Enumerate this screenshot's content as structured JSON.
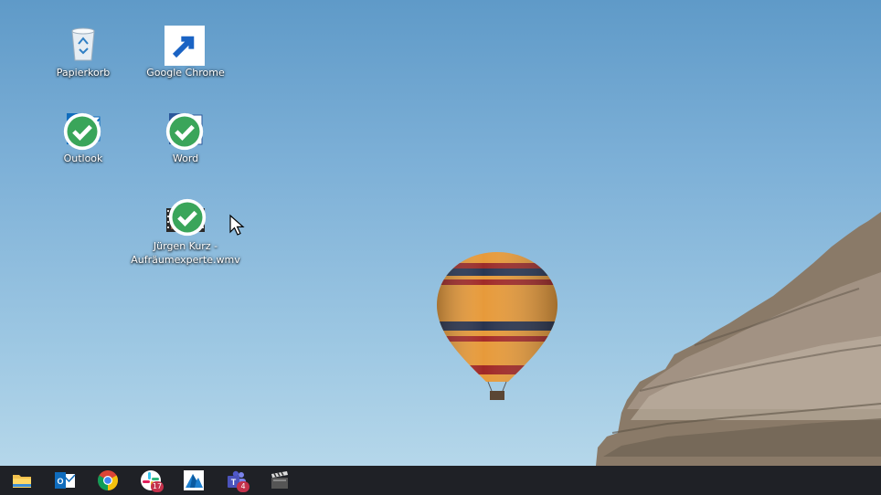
{
  "desktop": {
    "icons": [
      {
        "label": "Papierkorb",
        "icon": "recycle-bin-icon"
      },
      {
        "label": "Google Chrome",
        "icon": "chrome-icon",
        "shortcut": true
      },
      {
        "label": "Outlook",
        "icon": "outlook-icon",
        "synced": true
      },
      {
        "label": "Word",
        "icon": "word-icon",
        "synced": true
      },
      {
        "label_line1": "Jürgen Kurz -",
        "label_line2": "Aufräumexperte.wmv",
        "icon": "video-file-icon",
        "synced": true
      }
    ]
  },
  "taskbar": {
    "items": [
      {
        "name": "file-explorer",
        "icon": "folder-icon"
      },
      {
        "name": "outlook",
        "icon": "outlook-icon"
      },
      {
        "name": "chrome",
        "icon": "chrome-icon"
      },
      {
        "name": "slack",
        "icon": "slack-icon",
        "badge": "17"
      },
      {
        "name": "app-blue",
        "icon": "mountain-app-icon"
      },
      {
        "name": "teams",
        "icon": "teams-icon",
        "badge": "4"
      },
      {
        "name": "video-editor",
        "icon": "clapperboard-icon"
      }
    ]
  },
  "colors": {
    "sky_top": "#5f9ac8",
    "sky_bottom": "#b5d7ea",
    "taskbar": "#1f2126",
    "word_blue": "#2b579a",
    "outlook_blue": "#0f6cbd"
  }
}
